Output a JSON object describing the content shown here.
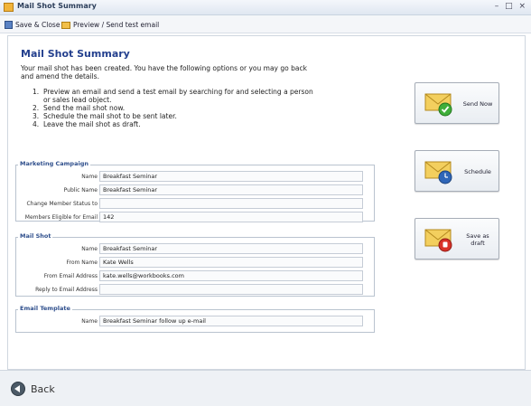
{
  "window": {
    "title": "Mail Shot Summary",
    "controls": "– □ ×"
  },
  "toolbar": {
    "save_close": "Save & Close",
    "preview": "Preview / Send test email"
  },
  "header": {
    "title": "Mail Shot Summary",
    "intro": "Your mail shot has been created. You have the following options or you may go back and amend the details."
  },
  "steps": [
    {
      "num": "1.",
      "text": "Preview an email and send a test email by searching for and selecting a person or sales lead object."
    },
    {
      "num": "2.",
      "text": "Send the mail shot now."
    },
    {
      "num": "3.",
      "text": "Schedule the mail shot to be sent later."
    },
    {
      "num": "4.",
      "text": "Leave the mail shot as draft."
    }
  ],
  "marketing_campaign": {
    "title": "Marketing Campaign",
    "fields": [
      {
        "label": "Name",
        "value": "Breakfast Seminar"
      },
      {
        "label": "Public Name",
        "value": "Breakfast Seminar"
      },
      {
        "label": "Change Member Status to",
        "value": ""
      },
      {
        "label": "Members Eligible for Email",
        "value": "142"
      }
    ]
  },
  "mail_shot": {
    "title": "Mail Shot",
    "fields": [
      {
        "label": "Name",
        "value": "Breakfast Seminar"
      },
      {
        "label": "From Name",
        "value": "Kate Wells"
      },
      {
        "label": "From Email Address",
        "value": "kate.wells@workbooks.com"
      },
      {
        "label": "Reply to Email Address",
        "value": ""
      }
    ]
  },
  "email_template": {
    "title": "Email Template",
    "fields": [
      {
        "label": "Name",
        "value": "Breakfast Seminar follow up e-mail"
      }
    ]
  },
  "actions": {
    "send_now": "Send Now",
    "schedule": "Schedule",
    "save_draft": "Save as draft"
  },
  "footer": {
    "back": "Back"
  },
  "colors": {
    "accent": "#24408e",
    "envelope": "#f3cf5e",
    "send_badge": "#3fae3a",
    "draft_badge": "#d93228",
    "schedule_badge": "#2f66b8"
  }
}
